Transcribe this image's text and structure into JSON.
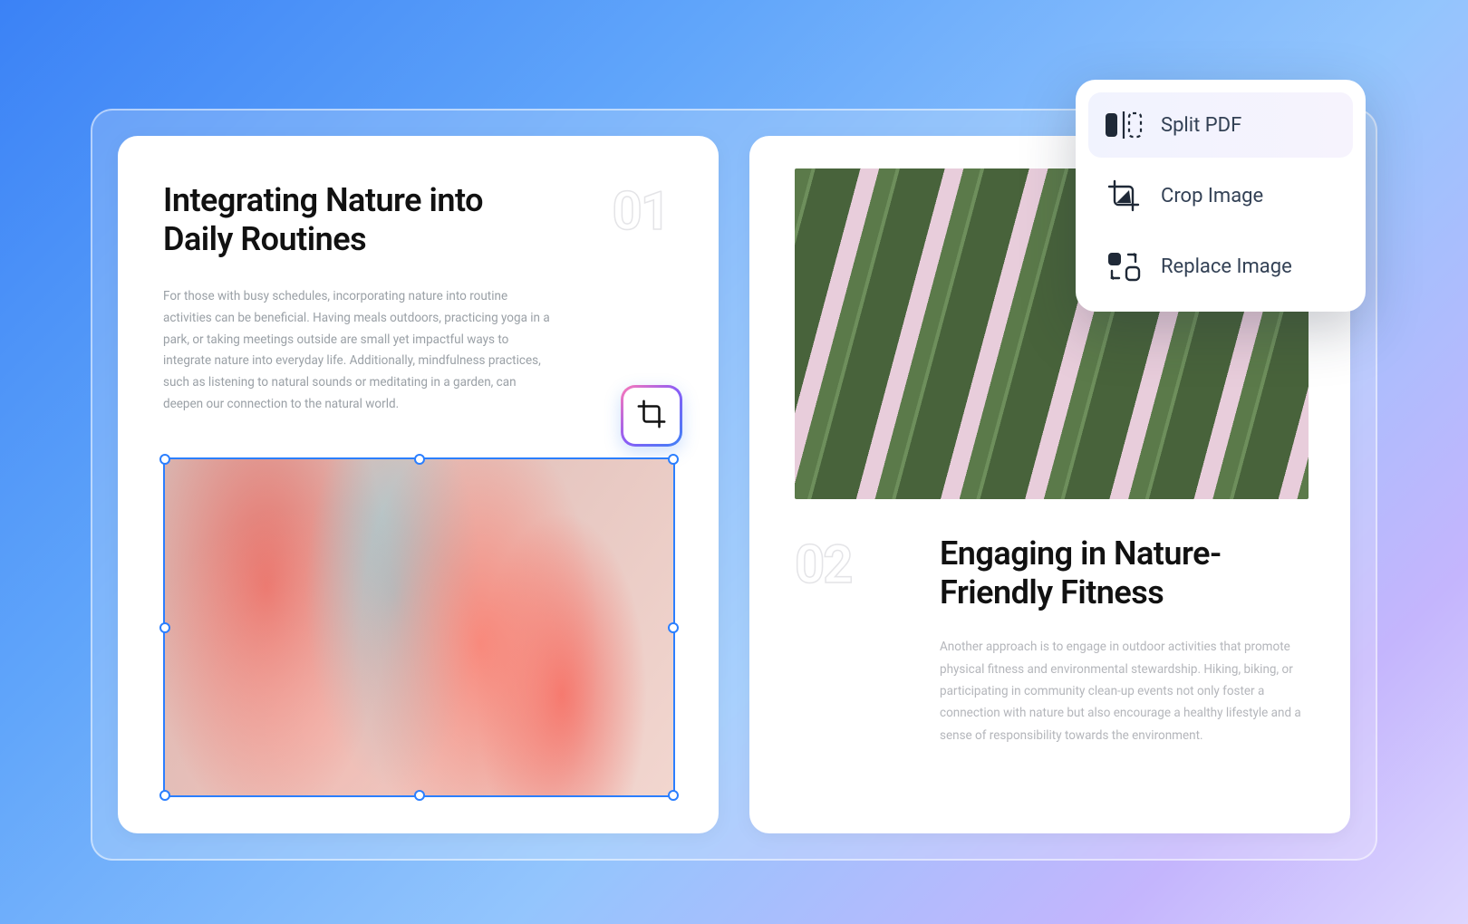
{
  "pages": [
    {
      "number": "01",
      "heading": "Integrating Nature into Daily Routines",
      "body": "For those with busy schedules, incorporating nature into routine activities can be beneficial. Having meals outdoors, practicing yoga in a park, or taking meetings outside are small yet impactful ways to integrate nature into everyday life. Additionally, mindfulness practices, such as listening to natural sounds or meditating in a garden, can deepen our connection to the natural world."
    },
    {
      "number": "02",
      "heading": "Engaging in Nature-Friendly Fitness",
      "body": "Another approach is to engage in outdoor activities that promote physical fitness and environmental stewardship. Hiking, biking, or participating in community clean-up events not only foster a connection with nature but also encourage a healthy lifestyle and a sense of responsibility towards the environment."
    }
  ],
  "contextMenu": {
    "items": [
      {
        "label": "Split PDF"
      },
      {
        "label": "Crop Image"
      },
      {
        "label": "Replace Image"
      }
    ]
  }
}
